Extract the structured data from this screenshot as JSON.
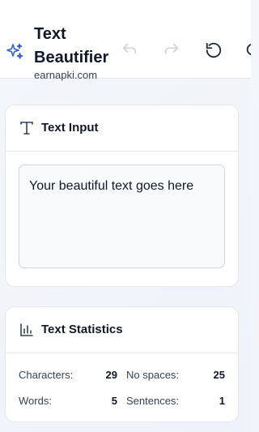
{
  "app": {
    "title_line1": "Text",
    "title_line2": "Beautifier",
    "subtitle": "earnapki.com",
    "logo_icon": "sparkles-icon",
    "accent_color": "#2f5fd6"
  },
  "toolbar": {
    "undo_icon": "undo-icon",
    "redo_icon": "redo-icon",
    "reset_icon": "reset-icon",
    "search_icon": "search-icon"
  },
  "input_card": {
    "title": "Text Input",
    "icon": "text-type-icon",
    "textarea_value": "Your beautiful text goes here"
  },
  "stats_card": {
    "title": "Text Statistics",
    "icon": "bar-chart-icon",
    "characters_label": "Characters:",
    "characters_value": "29",
    "no_spaces_label": "No spaces:",
    "no_spaces_value": "25",
    "words_label": "Words:",
    "words_value": "5",
    "sentences_label": "Sentences:",
    "sentences_value": "1"
  }
}
